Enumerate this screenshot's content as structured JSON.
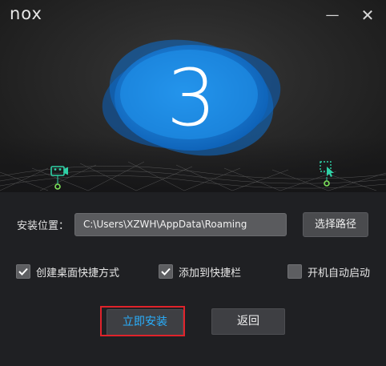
{
  "window": {
    "logo_text": "nox",
    "minimize_symbol": "—",
    "close_symbol": "✕"
  },
  "banner": {
    "step_number": "3",
    "accent_color": "#1a86e0",
    "left_icon": "video-camera-icon",
    "right_icon": "drag-select-icon"
  },
  "settings": {
    "path_label": "安装位置：",
    "path_value": "C:\\Users\\XZWH\\AppData\\Roaming",
    "browse_label": "选择路径",
    "options": [
      {
        "label": "创建桌面快捷方式",
        "checked": true
      },
      {
        "label": "添加到快捷栏",
        "checked": true
      },
      {
        "label": "开机自动启动",
        "checked": false
      }
    ]
  },
  "actions": {
    "install_label": "立即安装",
    "back_label": "返回",
    "install_color": "#29b0ff",
    "highlight_color": "#e0232b"
  }
}
